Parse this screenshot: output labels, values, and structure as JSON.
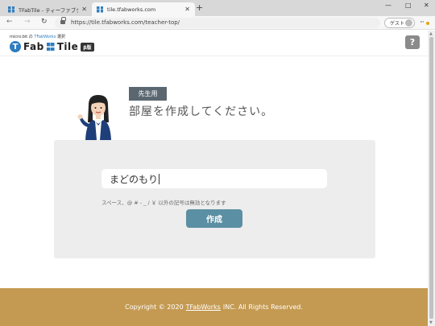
{
  "browser": {
    "tabs": [
      {
        "title": "TFabTile - ティーファブタイル",
        "active": false
      },
      {
        "title": "tile.tfabworks.com",
        "active": true
      }
    ],
    "new_tab": "+",
    "window_controls": {
      "minimize": "—",
      "maximize": "□",
      "close": "✕"
    },
    "nav": {
      "back": "←",
      "forward": "→",
      "refresh": "↻"
    },
    "url": "https://tile.tfabworks.com/teacher-top/",
    "profile_label": "ゲスト",
    "more": "···"
  },
  "header": {
    "microbit_prefix": "micro:bit の",
    "microbit_tfw": "TFabWorks",
    "microbit_suffix": "選択",
    "logo_t": "T",
    "logo_fab": "Fab",
    "logo_tile": "Tile",
    "logo_badge": "β版",
    "help_label": "?"
  },
  "main": {
    "role_badge": "先生用",
    "headline": "部屋を作成してください。",
    "room_name_value": "まどのもり",
    "hint": "スペース、@ # - _ / ￥ 以外の記号は無効となります",
    "create_button": "作成"
  },
  "footer": {
    "prefix": "Copyright © 2020",
    "link": "TFabWorks",
    "suffix": "INC. All Rights Reserved."
  },
  "colors": {
    "brand_blue": "#2f7dc0",
    "badge_gray": "#5b6770",
    "button_teal": "#5b8fa3",
    "footer_gold": "#c49a52",
    "card_gray": "#ededed"
  }
}
